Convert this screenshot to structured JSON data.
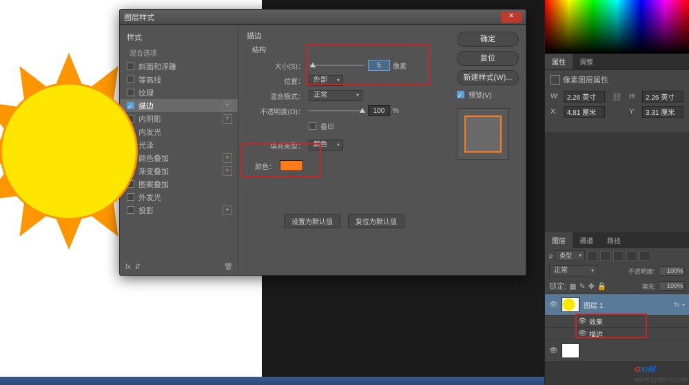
{
  "dialog": {
    "title": "图层样式",
    "styles_heading": "样式",
    "blending_options": "混合选项",
    "items": [
      {
        "label": "斜面和浮雕"
      },
      {
        "label": "等高线"
      },
      {
        "label": "纹理"
      },
      {
        "label": "描边",
        "active": true
      },
      {
        "label": "内阴影"
      },
      {
        "label": "内发光"
      },
      {
        "label": "光泽"
      },
      {
        "label": "颜色叠加"
      },
      {
        "label": "渐变叠加"
      },
      {
        "label": "图案叠加"
      },
      {
        "label": "外发光"
      },
      {
        "label": "投影"
      }
    ],
    "settings_heading": "描边",
    "structure": "结构",
    "size_label": "大小(S)：",
    "size_value": "5",
    "px": "像素",
    "position_label": "位置：",
    "position_value": "外部",
    "blend_mode_label": "混合模式：",
    "blend_mode_value": "正常",
    "opacity_label": "不透明度(O)：",
    "opacity_value": "100",
    "percent": "%",
    "overprint": "叠印",
    "fill_type_label": "填充类型：",
    "fill_type_value": "颜色",
    "color_label": "颜色：",
    "color_value": "#ff7a1a",
    "set_default": "设置为默认值",
    "reset_default": "复位为默认值",
    "ok": "确定",
    "reset": "复位",
    "new_style": "新建样式(W)...",
    "preview": "预览(V)"
  },
  "props": {
    "tab1": "属性",
    "tab2": "调整",
    "title": "像素图层属性",
    "w_label": "W:",
    "w_value": "2.26 英寸",
    "h_label": "H:",
    "h_value": "2.26 英寸",
    "x_label": "X:",
    "x_value": "4.81 厘米",
    "y_label": "Y:",
    "y_value": "3.31 厘米"
  },
  "layers": {
    "tab1": "图层",
    "tab2": "通道",
    "tab3": "路径",
    "filter_label": "类型",
    "blend_mode": "正常",
    "opacity_label": "不透明度:",
    "opacity_value": "100%",
    "lock_label": "锁定:",
    "fill_label": "填充:",
    "fill_value": "100%",
    "layer1": "图层 1",
    "fx": "fx",
    "effects": "效果",
    "stroke": "描边"
  },
  "watermark": {
    "brand_g": "G",
    "brand_rest": "XI网",
    "url": "www.system.com"
  }
}
